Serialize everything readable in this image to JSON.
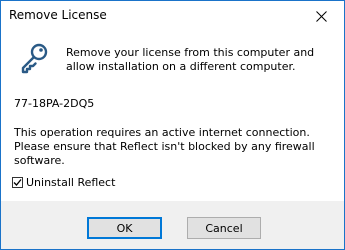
{
  "window": {
    "title": "Remove License",
    "close_icon": "close-icon"
  },
  "content": {
    "icon": "key-icon",
    "description": "Remove your license from this computer and allow installation on a different computer.",
    "license_key": "77-18PA-2DQ5",
    "note": "This operation requires an active internet connection. Please ensure that Reflect isn't blocked by any firewall software.",
    "uninstall_checkbox": {
      "label": "Uninstall Reflect",
      "checked": true
    }
  },
  "footer": {
    "ok_label": "OK",
    "cancel_label": "Cancel"
  },
  "colors": {
    "accent": "#0078d7",
    "icon": "#2a5a86"
  }
}
